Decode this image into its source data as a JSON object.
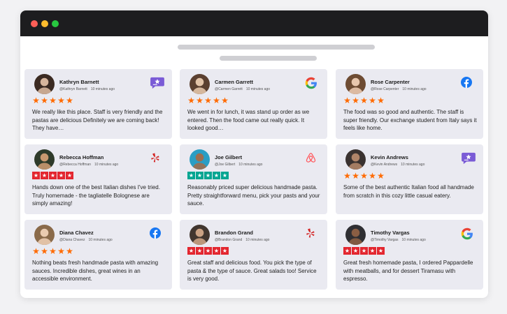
{
  "colors": {
    "star_orange": "#ff6a00",
    "star_red": "#e3262f",
    "star_teal": "#00a591",
    "window_bg": "#ffffff",
    "titlebar": "#1d1d1f",
    "card_bg": "#eaeaf1"
  },
  "reviews": [
    {
      "name": "Kathryn Barnett",
      "handle": "@Kathryn Barnett",
      "time": "10 minutes ago",
      "platform": "review-widget-icon",
      "rating": 5,
      "star_style": "orange",
      "text": "We really like this place.  Staff is very friendly and the pastas are delicious Definitely we are coming back!  They have…"
    },
    {
      "name": "Carmen Garrett",
      "handle": "@Carmen Garrett",
      "time": "10 minutes ago",
      "platform": "google-icon",
      "rating": 5,
      "star_style": "orange",
      "text": "We went in for lunch, it was stand up order as we entered. Then the food came out really quick. It looked good…"
    },
    {
      "name": "Rose Carpenter",
      "handle": "@Rose Carpenter",
      "time": "10 minutes ago",
      "platform": "facebook-icon",
      "rating": 5,
      "star_style": "orange",
      "text": "The food was so good and authentic. The staff is super friendly. Our exchange student from Italy says it feels like home."
    },
    {
      "name": "Rebecca Hoffman",
      "handle": "@Rebecca Hoffman",
      "time": "10 minutes ago",
      "platform": "yelp-icon",
      "rating": 5,
      "star_style": "red",
      "text": "Hands down one of the best Italian dishes I've tried. Truly homemade - the tagliatelle Bolognese are simply amazing!"
    },
    {
      "name": "Joe Gilbert",
      "handle": "@Joe Gilbert",
      "time": "10 minutes ago",
      "platform": "airbnb-icon",
      "rating": 5,
      "star_style": "teal",
      "text": "Reasonably priced super delicious handmade pasta. Pretty straightforward menu, pick your pasts and your sauce."
    },
    {
      "name": "Kevin Andrews",
      "handle": "@Kevin Andrews",
      "time": "10 minutes ago",
      "platform": "review-widget-icon",
      "rating": 5,
      "star_style": "orange",
      "text": "Some of the best authentic Italian food all handmade from scratch in this cozy little casual eatery."
    },
    {
      "name": "Diana Chavez",
      "handle": "@Diana Chavez",
      "time": "10 minutes ago",
      "platform": "facebook-icon",
      "rating": 5,
      "star_style": "orange",
      "text": "Nothing beats fresh handmade pasta with amazing sauces. Incredible dishes, great wines in an accessible environment."
    },
    {
      "name": "Brandon Grand",
      "handle": "@Brandon Grand",
      "time": "10 minutes ago",
      "platform": "yelp-icon",
      "rating": 5,
      "star_style": "red",
      "text": "Great staff and delicious food. You pick the type of pasta & the type of sauce. Great salads too! Service is very good."
    },
    {
      "name": "Timothy Vargas",
      "handle": "@Timothy Vargas",
      "time": "10 minutes ago",
      "platform": "google-icon",
      "rating": 5,
      "star_style": "red",
      "text": "Great fresh homemade pasta, I ordered Pappardelle with meatballs, and for dessert Tiramasu with espresso."
    }
  ]
}
